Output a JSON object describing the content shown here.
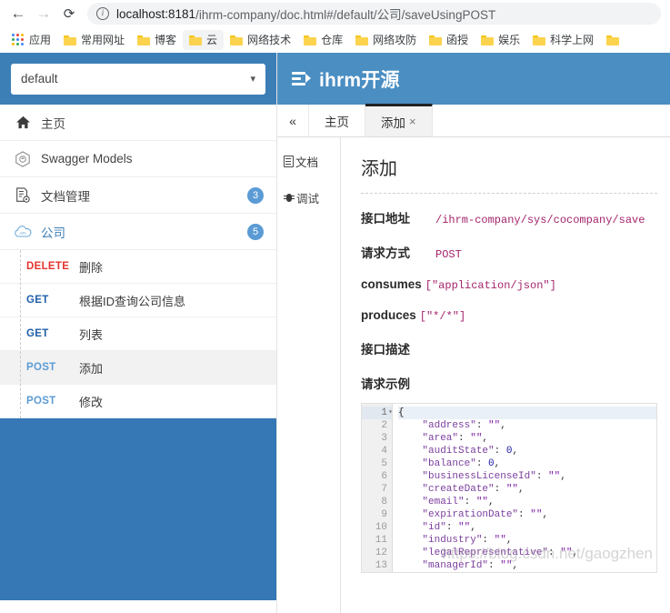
{
  "browser": {
    "back_icon": "arrow-left-icon",
    "forward_icon": "arrow-right-icon",
    "reload_icon": "reload-icon",
    "info_glyph": "i",
    "url_host": "localhost:8181",
    "url_rest": "/ihrm-company/doc.html#/default/公司/saveUsingPOST",
    "url_full": "localhost:8181/ihrm-company/doc.html#/default/公司/saveUsingPOST",
    "bookmarks": [
      {
        "label": "应用",
        "icon": "apps-grid-icon",
        "highlight": false
      },
      {
        "label": "常用网址",
        "icon": "folder-icon",
        "highlight": false
      },
      {
        "label": "博客",
        "icon": "folder-icon",
        "highlight": false
      },
      {
        "label": "云",
        "icon": "folder-icon",
        "highlight": true
      },
      {
        "label": "网络技术",
        "icon": "folder-icon",
        "highlight": false
      },
      {
        "label": "仓库",
        "icon": "folder-icon",
        "highlight": false
      },
      {
        "label": "网络攻防",
        "icon": "folder-icon",
        "highlight": false
      },
      {
        "label": "函授",
        "icon": "folder-icon",
        "highlight": false
      },
      {
        "label": "娱乐",
        "icon": "folder-icon",
        "highlight": false
      },
      {
        "label": "科学上网",
        "icon": "folder-icon",
        "highlight": false
      },
      {
        "label": "",
        "icon": "folder-icon",
        "highlight": false
      }
    ]
  },
  "sidebar": {
    "group_select_value": "default",
    "group_select_caret": "⌄",
    "items": [
      {
        "label": "主页",
        "icon": "home-icon",
        "badge": "",
        "active": false
      },
      {
        "label": "Swagger Models",
        "icon": "swagger-cube-icon",
        "badge": "",
        "active": false
      },
      {
        "label": "文档管理",
        "icon": "doc-settings-icon",
        "badge": "3",
        "active": false
      },
      {
        "label": "公司",
        "icon": "cloud-api-icon",
        "badge": "5",
        "active": true
      }
    ],
    "api_list": [
      {
        "method": "DELETE",
        "name": "删除",
        "selected": false
      },
      {
        "method": "GET",
        "name": "根据ID查询公司信息",
        "selected": false
      },
      {
        "method": "GET",
        "name": "列表",
        "selected": false
      },
      {
        "method": "POST",
        "name": "添加",
        "selected": true
      },
      {
        "method": "POST",
        "name": "修改",
        "selected": false
      }
    ]
  },
  "app": {
    "logo_icon": "indent-list-icon",
    "title": "ihrm开源",
    "collapse_icon": "double-chevron-left-icon",
    "tabs": [
      {
        "label": "主页",
        "closable": false,
        "active": false
      },
      {
        "label": "添加",
        "closable": true,
        "close_glyph": "×",
        "active": true
      }
    ],
    "vertical_tabs": [
      {
        "label": "文档",
        "icon": "document-icon",
        "active": true
      },
      {
        "label": "调试",
        "icon": "bug-icon",
        "active": false
      }
    ]
  },
  "doc": {
    "title": "添加",
    "fields": [
      {
        "key": "接口地址",
        "value": "/ihrm-company/sys/cocompany/save"
      },
      {
        "key": "请求方式",
        "value": "POST"
      },
      {
        "key": "consumes",
        "value": "[\"application/json\"]"
      },
      {
        "key": "produces",
        "value": "[\"*/*\"]"
      }
    ],
    "description_heading": "接口描述",
    "description_value": "",
    "request_example_heading": "请求示例",
    "code_lines": [
      {
        "n": "1",
        "indent": 0,
        "text": "{",
        "type": "brace",
        "fold": "▾"
      },
      {
        "n": "2",
        "indent": 1,
        "key": "address",
        "value": "\"\"",
        "vtype": "str",
        "comma": true
      },
      {
        "n": "3",
        "indent": 1,
        "key": "area",
        "value": "\"\"",
        "vtype": "str",
        "comma": true
      },
      {
        "n": "4",
        "indent": 1,
        "key": "auditState",
        "value": "0",
        "vtype": "num",
        "comma": true
      },
      {
        "n": "5",
        "indent": 1,
        "key": "balance",
        "value": "0",
        "vtype": "num",
        "comma": true
      },
      {
        "n": "6",
        "indent": 1,
        "key": "businessLicenseId",
        "value": "\"\"",
        "vtype": "str",
        "comma": true
      },
      {
        "n": "7",
        "indent": 1,
        "key": "createDate",
        "value": "\"\"",
        "vtype": "str",
        "comma": true
      },
      {
        "n": "8",
        "indent": 1,
        "key": "email",
        "value": "\"\"",
        "vtype": "str",
        "comma": true
      },
      {
        "n": "9",
        "indent": 1,
        "key": "expirationDate",
        "value": "\"\"",
        "vtype": "str",
        "comma": true
      },
      {
        "n": "10",
        "indent": 1,
        "key": "id",
        "value": "\"\"",
        "vtype": "str",
        "comma": true
      },
      {
        "n": "11",
        "indent": 1,
        "key": "industry",
        "value": "\"\"",
        "vtype": "str",
        "comma": true
      },
      {
        "n": "12",
        "indent": 1,
        "key": "legalRepresentative",
        "value": "\"\"",
        "vtype": "str",
        "comma": true
      },
      {
        "n": "13",
        "indent": 1,
        "key": "managerId",
        "value": "\"\"",
        "vtype": "str",
        "comma": true
      }
    ]
  },
  "watermark": "https://blog.csdn.net/gaogzhen",
  "colors": {
    "header_blue": "#4a8ec2",
    "sidebar_header_blue": "#3c7fb7",
    "sidebar_fill_blue": "#3578b5",
    "badge_blue": "#5b9bd5",
    "method_delete": "#e3342f",
    "method_get": "#1f5fa9",
    "method_post": "#5b9bd5",
    "code_value": "#a3246b"
  }
}
